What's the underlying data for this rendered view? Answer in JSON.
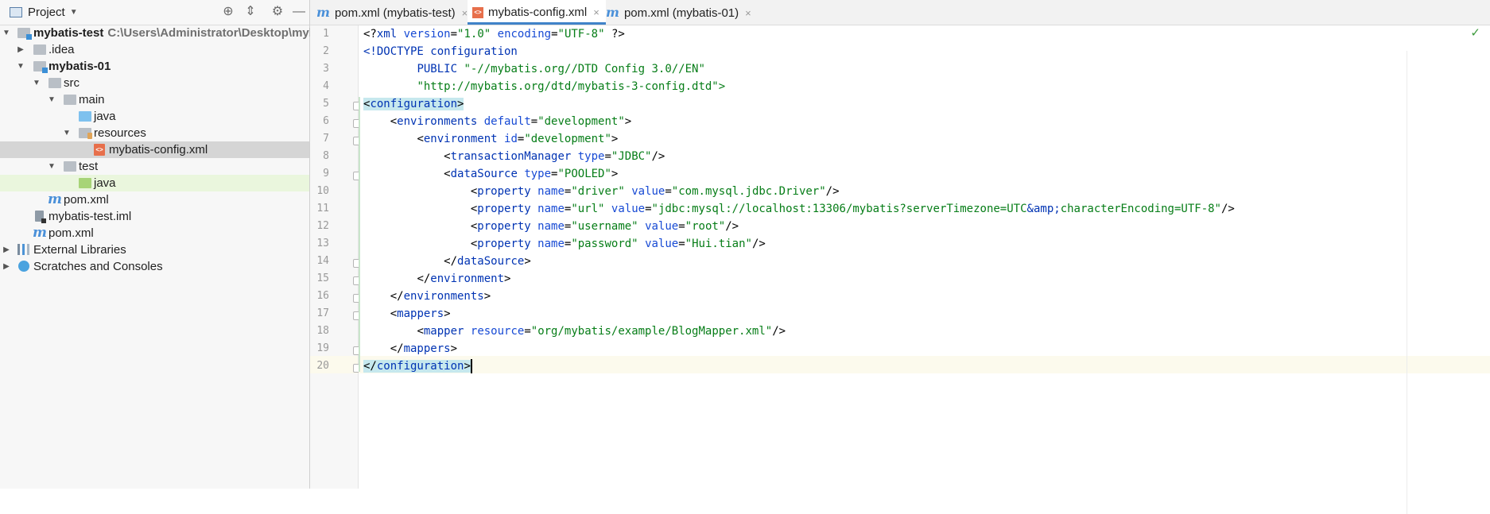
{
  "project_panel": {
    "title": "Project",
    "tools": [
      "locate-icon",
      "collapse-icon",
      "gear-icon",
      "minimize-icon"
    ],
    "tree": [
      {
        "label": "mybatis-test",
        "path": "C:\\Users\\Administrator\\Desktop\\mybatis-te",
        "icon": "module-folder-icon",
        "bold": true
      },
      {
        "label": ".idea",
        "icon": "folder-icon"
      },
      {
        "label": "mybatis-01",
        "icon": "module-folder-icon",
        "bold": true
      },
      {
        "label": "src",
        "icon": "folder-icon"
      },
      {
        "label": "main",
        "icon": "folder-icon"
      },
      {
        "label": "java",
        "icon": "source-folder-icon"
      },
      {
        "label": "resources",
        "icon": "resources-folder-icon"
      },
      {
        "label": "mybatis-config.xml",
        "icon": "xml-file-icon",
        "selected": true
      },
      {
        "label": "test",
        "icon": "folder-icon"
      },
      {
        "label": "java",
        "icon": "test-source-folder-icon"
      },
      {
        "label": "pom.xml",
        "icon": "maven-icon"
      },
      {
        "label": "mybatis-test.iml",
        "icon": "iml-file-icon"
      },
      {
        "label": "pom.xml",
        "icon": "maven-icon"
      },
      {
        "label": "External Libraries",
        "icon": "libraries-icon"
      },
      {
        "label": "Scratches and Consoles",
        "icon": "scratches-icon"
      }
    ]
  },
  "editor": {
    "tabs": [
      {
        "label": "pom.xml (mybatis-test)",
        "icon": "maven-icon",
        "active": false
      },
      {
        "label": "mybatis-config.xml",
        "icon": "xml-file-icon",
        "active": true
      },
      {
        "label": "pom.xml (mybatis-01)",
        "icon": "maven-icon",
        "active": false
      }
    ],
    "close_glyph": "×",
    "line_numbers": [
      "1",
      "2",
      "3",
      "4",
      "5",
      "6",
      "7",
      "8",
      "9",
      "10",
      "11",
      "12",
      "13",
      "14",
      "15",
      "16",
      "17",
      "18",
      "19",
      "20"
    ],
    "tokens": {
      "xml_decl_open": "<?",
      "xml": "xml",
      "version_attr": "version",
      "version_val": "\"1.0\"",
      "encoding_attr": "encoding",
      "encoding_val": "\"UTF-8\"",
      "xml_decl_close": "?>",
      "doctype": "<!DOCTYPE configuration",
      "public": "PUBLIC",
      "public_id": "\"-//mybatis.org//DTD Config 3.0//EN\"",
      "dtd_url": "\"http://mybatis.org/dtd/mybatis-3-config.dtd\">",
      "lt": "<",
      "gt": ">",
      "lt_slash": "</",
      "self_close": "/>",
      "eq": "=",
      "configuration": "configuration",
      "environments": "environments",
      "default_attr": "default",
      "default_val": "\"development\"",
      "environment": "environment",
      "id_attr": "id",
      "id_val": "\"development\"",
      "transactionManager": "transactionManager",
      "type_attr": "type",
      "tm_type_val": "\"JDBC\"",
      "dataSource": "dataSource",
      "ds_type_val": "\"POOLED\"",
      "property": "property",
      "name_attr": "name",
      "value_attr": "value",
      "driver_name": "\"driver\"",
      "driver_val": "\"com.mysql.jdbc.Driver\"",
      "url_name": "\"url\"",
      "url_val_1": "\"jdbc:mysql://localhost:13306/mybatis?serverTimezone=UTC",
      "amp": "&amp;",
      "url_val_2": "characterEncoding=UTF-8\"",
      "username_name": "\"username\"",
      "username_val": "\"root\"",
      "password_name": "\"password\"",
      "password_val": "\"Hui.tian\"",
      "mappers": "mappers",
      "mapper": "mapper",
      "resource_attr": "resource",
      "resource_val": "\"org/mybatis/example/BlogMapper.xml\""
    }
  },
  "colors": {
    "tag": "#0033b3",
    "attribute": "#174ad4",
    "string": "#067d17",
    "active_tab_underline": "#4083c9",
    "selection": "#d5d5d5",
    "current_line": "#fcfaed"
  }
}
